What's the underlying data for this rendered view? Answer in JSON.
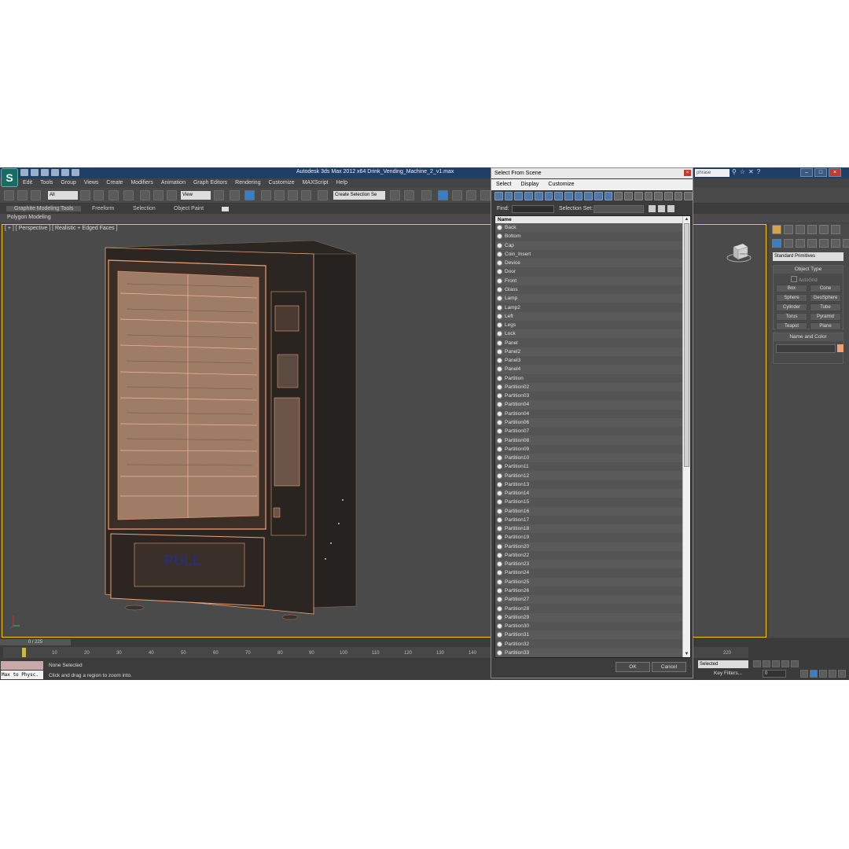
{
  "window": {
    "title": "Autodesk 3ds Max  2012 x64     Drink_Vending_Machine_2_v1.max",
    "search_placeholder": "phrase",
    "min": "–",
    "max": "□",
    "close": "×"
  },
  "app_logo": "S",
  "menu": [
    "Edit",
    "Tools",
    "Group",
    "Views",
    "Create",
    "Modifiers",
    "Animation",
    "Graph Editors",
    "Rendering",
    "Customize",
    "MAXScript",
    "Help"
  ],
  "toolbar": {
    "filter_value": "All",
    "ref_coord_value": "View",
    "named_selection_placeholder": "Create Selection Se"
  },
  "ribbon": {
    "tabs": [
      "Graphite Modeling Tools",
      "Freeform",
      "Selection",
      "Object Paint"
    ],
    "subtitle": "Polygon Modeling"
  },
  "viewport": {
    "label": "[ + ] [ Perspective ] [ Realistic + Edged Faces ]",
    "decal_text": "PULL",
    "viewcube_label": "FRONT"
  },
  "command_panel": {
    "dropdown_value": "Standard Primitives",
    "object_type_title": "Object Type",
    "autogrid_label": "AutoGrid",
    "buttons": [
      "Box",
      "Cone",
      "Sphere",
      "GeoSphere",
      "Cylinder",
      "Tube",
      "Torus",
      "Pyramid",
      "Teapot",
      "Plane"
    ],
    "name_color_title": "Name and Color",
    "color": "#f1a075"
  },
  "timeline": {
    "slider_label": "0 / 225",
    "ticks": [
      "10",
      "20",
      "30",
      "40",
      "50",
      "60",
      "70",
      "80",
      "90",
      "100",
      "110",
      "120",
      "130",
      "140"
    ],
    "right_tick": "220"
  },
  "status": {
    "maxscript": "Max to Physc.",
    "selection": "None Selected",
    "prompt": "Click and drag a region to zoom into.",
    "selected_dropdown": "Selected",
    "key_filters": "Key Filters...",
    "frame": "0"
  },
  "dialog": {
    "title": "Select From Scene",
    "close": "×",
    "menu": [
      "Select",
      "Display",
      "Customize"
    ],
    "find_label": "Find:",
    "selection_set_label": "Selection Set:",
    "column_header": "Name",
    "ok": "OK",
    "cancel": "Cancel",
    "scroll_up": "▲",
    "scroll_down": "▼",
    "objects": [
      "Back",
      "Bottom",
      "Cap",
      "Coin_Insert",
      "Device",
      "Door",
      "Front",
      "Glass",
      "Lamp",
      "Lamp2",
      "Left",
      "Legs",
      "Lock",
      "Panel",
      "Panel2",
      "Panel3",
      "Panel4",
      "Partition",
      "Partition02",
      "Partition03",
      "Partition04",
      "Partition04",
      "Partition06",
      "Partition07",
      "Partition08",
      "Partition09",
      "Partition10",
      "Partition11",
      "Partition12",
      "Partition13",
      "Partition14",
      "Partition15",
      "Partition16",
      "Partition17",
      "Partition18",
      "Partition19",
      "Partition20",
      "Partition22",
      "Partition23",
      "Partition24",
      "Partition25",
      "Partition26",
      "Partition27",
      "Partition28",
      "Partition29",
      "Partition30",
      "Partition31",
      "Partition32",
      "Partition33"
    ]
  }
}
